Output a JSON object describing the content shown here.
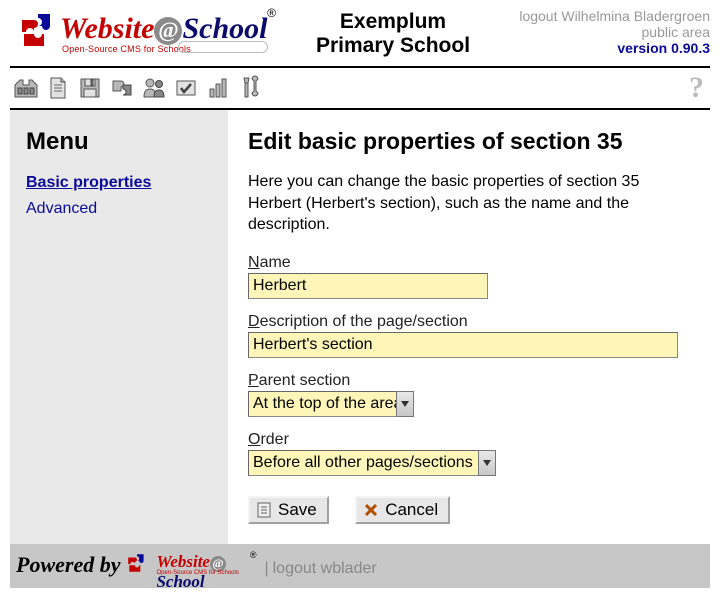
{
  "header": {
    "brand_word1": "Website",
    "brand_word2": "School",
    "brand_sub": "Open-Source CMS for Schools",
    "reg_mark": "®",
    "school_line1": "Exemplum",
    "school_line2": "Primary School",
    "logout_text": "logout Wilhelmina Bladergroen",
    "area_text": "public area",
    "version": "version 0.90.3"
  },
  "toolbar": {
    "help": "?"
  },
  "sidebar": {
    "title": "Menu",
    "items": [
      {
        "label": "Basic properties",
        "active": true
      },
      {
        "label": "Advanced",
        "active": false
      }
    ]
  },
  "main": {
    "heading": "Edit basic properties of section 35",
    "intro": "Here you can change the basic properties of section 35 Herbert (Herbert's section), such as the name and the description.",
    "fields": {
      "name_label_accesskey": "N",
      "name_label_rest": "ame",
      "name_value": "Herbert",
      "desc_label_accesskey": "D",
      "desc_label_rest": "escription of the page/section",
      "desc_value": "Herbert's section",
      "parent_label_accesskey": "P",
      "parent_label_rest": "arent section",
      "parent_value": "At the top of the area",
      "order_label_accesskey": "O",
      "order_label_rest": "rder",
      "order_value": "Before all other pages/sections"
    },
    "buttons": {
      "save": "Save",
      "cancel": "Cancel"
    }
  },
  "footer": {
    "powered": "Powered by",
    "logout": "logout wblader",
    "sep": "|"
  }
}
